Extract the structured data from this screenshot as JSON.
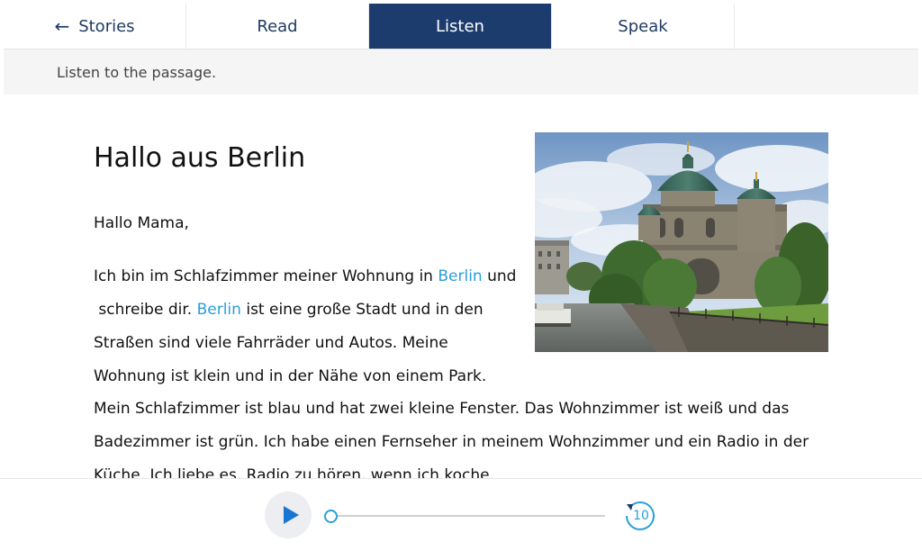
{
  "tabs": {
    "stories": "Stories",
    "read": "Read",
    "listen": "Listen",
    "speak": "Speak"
  },
  "instruction": "Listen to the passage.",
  "story": {
    "title": "Hallo aus Berlin",
    "salutation": "Hallo Mama,",
    "p1_l1_a": "Ich bin im Schlafzimmer meiner Wohnung in ",
    "p1_l1_link": "Berlin",
    "p1_l1_b": " und",
    "p1_l2_a": " schreibe dir. ",
    "p1_l2_link": "Berlin",
    "p1_l2_b": " ist eine große Stadt und in den",
    "p1_l3": "Straßen sind viele Fahrräder und Autos. Meine",
    "p1_l4": "Wohnung ist klein und in der Nähe von einem Park.",
    "p2_l1": "Mein Schlafzimmer ist blau und hat zwei kleine Fenster. Das Wohnzimmer ist weiß und das",
    "p2_l2": "Badezimmer ist grün. Ich habe einen Fernseher in meinem Wohnzimmer und ein Radio in der",
    "p2_l3": "Küche. Ich liebe es, Radio zu hören, wenn ich koche."
  },
  "player": {
    "progress": 0,
    "rewind_seconds": "10"
  },
  "colors": {
    "active_tab": "#1c3c6e",
    "link": "#2a9fd8",
    "play_icon": "#1976d2"
  },
  "icons": {
    "back": "arrow-left-icon",
    "play": "play-icon",
    "rewind": "rewind-10-icon"
  }
}
